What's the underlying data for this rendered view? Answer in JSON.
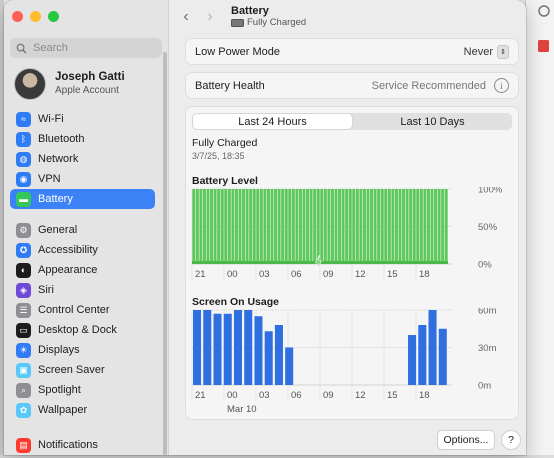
{
  "sidebar": {
    "search_placeholder": "Search",
    "account": {
      "name": "Joseph Gatti",
      "subtitle": "Apple Account"
    },
    "groups": [
      [
        {
          "label": "Wi-Fi",
          "icon": "wifi-icon",
          "color": "#2f7cf6",
          "glyph": "≈"
        },
        {
          "label": "Bluetooth",
          "icon": "bluetooth-icon",
          "color": "#2f7cf6",
          "glyph": "ᛒ"
        },
        {
          "label": "Network",
          "icon": "globe-icon",
          "color": "#2f7cf6",
          "glyph": "◍"
        },
        {
          "label": "VPN",
          "icon": "vpn-icon",
          "color": "#2f7cf6",
          "glyph": "◉"
        },
        {
          "label": "Battery",
          "icon": "battery-icon",
          "color": "#34c759",
          "glyph": "▬",
          "active": true
        }
      ],
      [
        {
          "label": "General",
          "icon": "gear-icon",
          "color": "#8e8e93",
          "glyph": "⚙"
        },
        {
          "label": "Accessibility",
          "icon": "accessibility-icon",
          "color": "#2f7cf6",
          "glyph": "✪"
        },
        {
          "label": "Appearance",
          "icon": "appearance-icon",
          "color": "#1c1c1e",
          "glyph": "◐"
        },
        {
          "label": "Siri",
          "icon": "siri-icon",
          "color": "#6d4bd8",
          "glyph": "◈"
        },
        {
          "label": "Control Center",
          "icon": "control-center-icon",
          "color": "#8e8e93",
          "glyph": "☰"
        },
        {
          "label": "Desktop & Dock",
          "icon": "dock-icon",
          "color": "#1c1c1e",
          "glyph": "▭"
        },
        {
          "label": "Displays",
          "icon": "displays-icon",
          "color": "#2f7cf6",
          "glyph": "☀"
        },
        {
          "label": "Screen Saver",
          "icon": "screen-saver-icon",
          "color": "#5ac8fa",
          "glyph": "▣"
        },
        {
          "label": "Spotlight",
          "icon": "spotlight-icon",
          "color": "#8e8e93",
          "glyph": "⌕"
        },
        {
          "label": "Wallpaper",
          "icon": "wallpaper-icon",
          "color": "#5ac8fa",
          "glyph": "✿"
        }
      ],
      [
        {
          "label": "Notifications",
          "icon": "notifications-icon",
          "color": "#ff3b30",
          "glyph": "▤"
        }
      ]
    ]
  },
  "header": {
    "title": "Battery",
    "subtitle": "Fully Charged"
  },
  "settings": {
    "low_power_label": "Low Power Mode",
    "low_power_value": "Never",
    "health_label": "Battery Health",
    "health_value": "Service Recommended"
  },
  "usage": {
    "tabs": [
      "Last 24 Hours",
      "Last 10 Days"
    ],
    "status_title": "Fully Charged",
    "status_date": "3/7/25, 18:35"
  },
  "colors": {
    "accent": "#3b82f6",
    "battery_green": "#5ec95b",
    "usage_blue": "#2f6fe0"
  },
  "chart_data": [
    {
      "type": "bar",
      "title": "Battery Level",
      "y_ticks": [
        "100%",
        "50%",
        "0%"
      ],
      "x_ticks": [
        "21",
        "00",
        "03",
        "06",
        "09",
        "12",
        "15",
        "18"
      ],
      "ylim": [
        0,
        100
      ],
      "bar_count": 72,
      "values_note": "constant",
      "value": 100,
      "charging_marker": true
    },
    {
      "type": "bar",
      "title": "Screen On Usage",
      "y_ticks": [
        "60m",
        "30m",
        "0m"
      ],
      "x_ticks": [
        "21",
        "00",
        "03",
        "06",
        "09",
        "12",
        "15",
        "18"
      ],
      "x_sublabel": "Mar 10",
      "ylim": [
        0,
        60
      ],
      "values": [
        60,
        60,
        57,
        57,
        60,
        60,
        55,
        43,
        48,
        30,
        0,
        0,
        0,
        0,
        0,
        0,
        0,
        0,
        0,
        0,
        0,
        40,
        48,
        60,
        45
      ]
    }
  ],
  "footer": {
    "options_label": "Options...",
    "help_label": "?"
  }
}
